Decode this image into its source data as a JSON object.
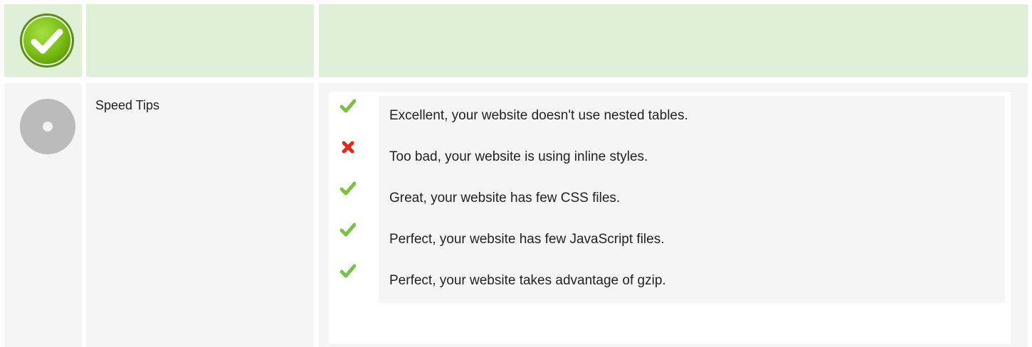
{
  "section": {
    "label": "Speed Tips"
  },
  "tips": [
    {
      "status": "pass",
      "icon": "check-icon",
      "text": "Excellent, your website doesn't use nested tables."
    },
    {
      "status": "fail",
      "icon": "cross-icon",
      "text": "Too bad, your website is using inline styles."
    },
    {
      "status": "pass",
      "icon": "check-icon",
      "text": "Great, your website has few CSS files."
    },
    {
      "status": "pass",
      "icon": "check-icon",
      "text": "Perfect, your website has few JavaScript files."
    },
    {
      "status": "pass",
      "icon": "check-icon",
      "text": "Perfect, your website takes advantage of gzip."
    }
  ],
  "colors": {
    "header_bg": "#def0d8",
    "row_bg": "#f5f5f5",
    "pass": "#7cc242",
    "fail": "#e8261b",
    "neutral_dot": "#bbbbbb"
  }
}
